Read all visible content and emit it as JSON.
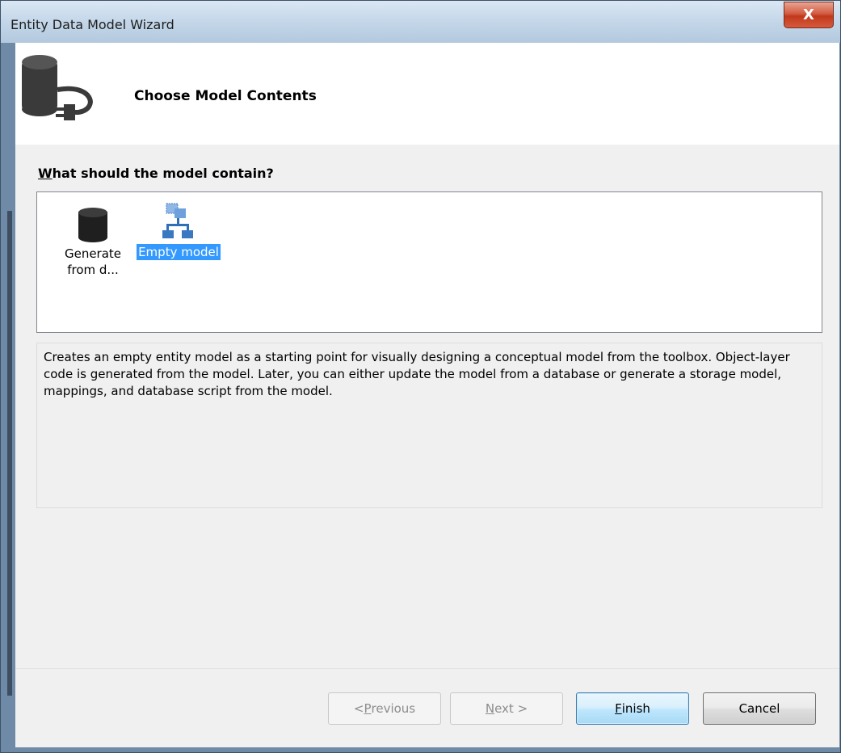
{
  "window": {
    "title": "Entity Data Model Wizard",
    "close_glyph": "X"
  },
  "header": {
    "title": "Choose Model Contents",
    "icon": "database-connect-icon"
  },
  "model_contents": {
    "label_access_key": "W",
    "label_rest": "hat should the model contain?",
    "items": [
      {
        "label_line1": "Generate",
        "label_line2": "from d...",
        "icon": "database-icon",
        "selected": false
      },
      {
        "label": "Empty model",
        "icon": "empty-model-icon",
        "selected": true
      }
    ],
    "selection_color": "#3399ff"
  },
  "description": "Creates an empty entity model as a starting point for visually designing a conceptual model from the toolbox. Object-layer code is generated from the model. Later, you can either update the model from a database or generate a storage model, mappings, and database script from the model.",
  "buttons": {
    "previous": {
      "prefix": "< ",
      "access_key": "P",
      "rest": "revious",
      "enabled": false
    },
    "next": {
      "access_key": "N",
      "rest": "ext >",
      "enabled": false
    },
    "finish": {
      "access_key": "F",
      "rest": "inish",
      "enabled": true
    },
    "cancel": {
      "label": "Cancel",
      "enabled": true
    }
  }
}
